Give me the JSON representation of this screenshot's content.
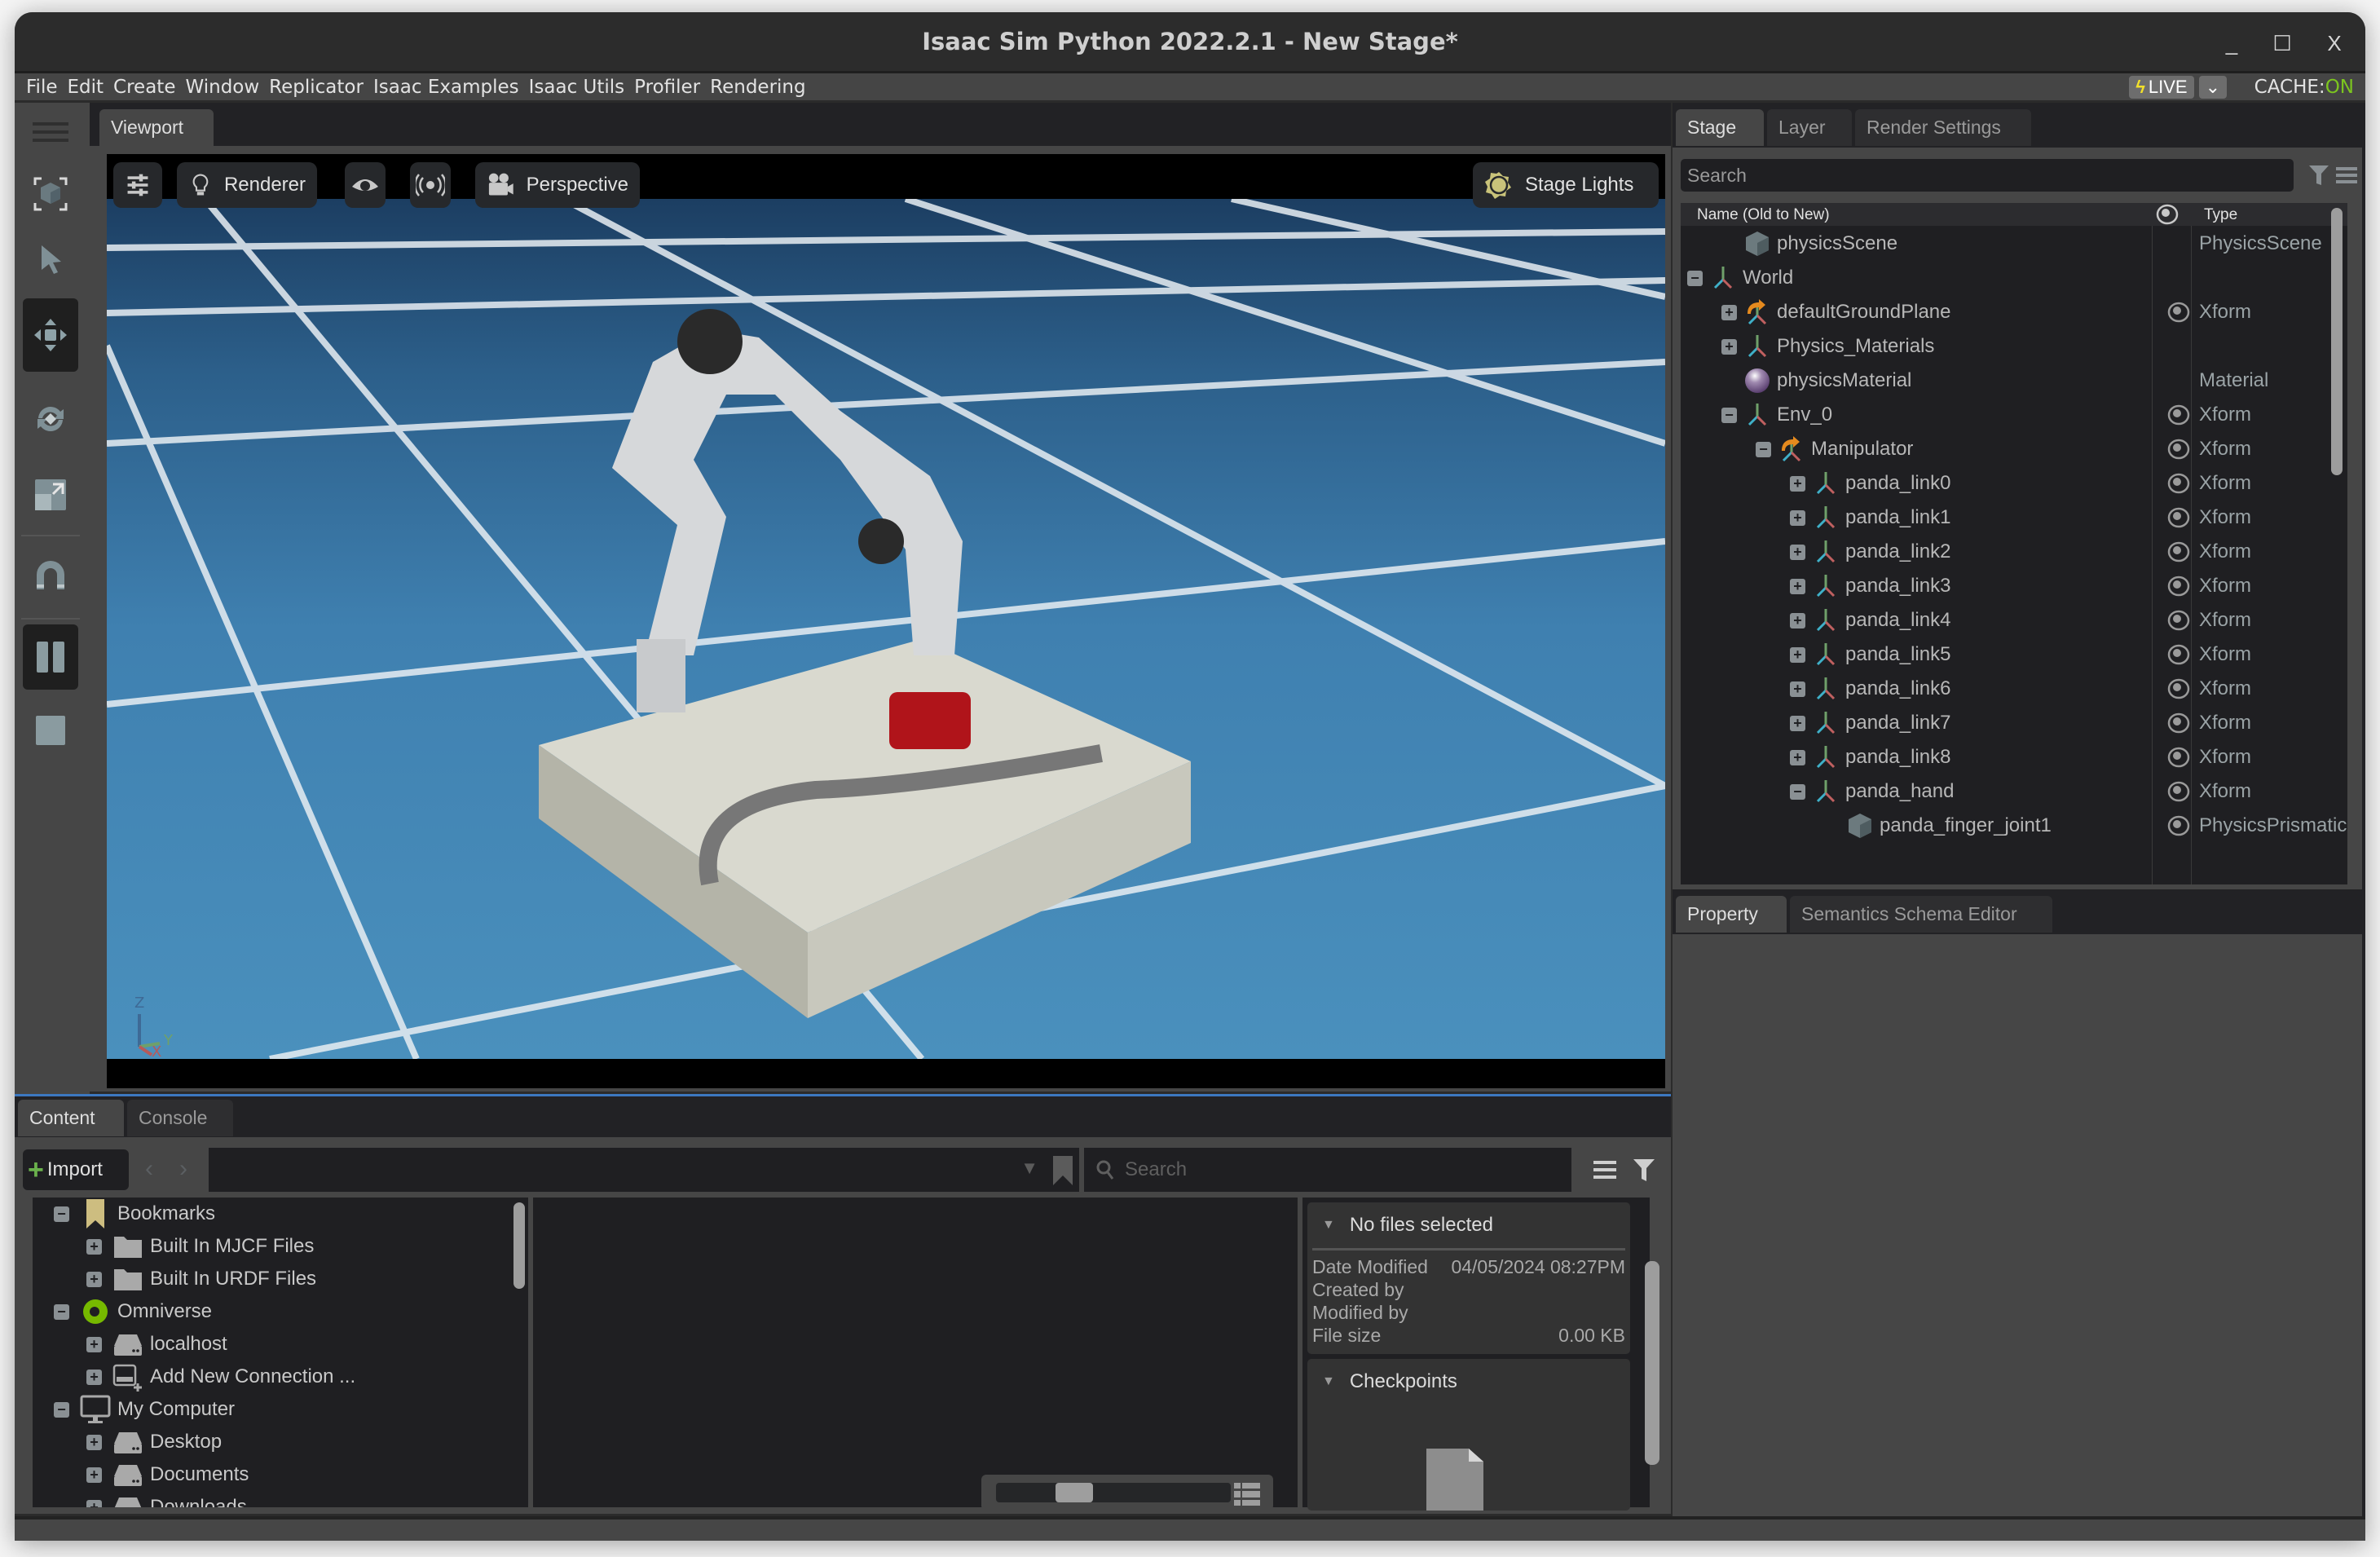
{
  "window": {
    "title": "Isaac Sim Python 2022.2.1 - New Stage*",
    "controls": {
      "minimize": "_",
      "maximize": "☐",
      "close": "X"
    }
  },
  "menu": [
    "File",
    "Edit",
    "Create",
    "Window",
    "Replicator",
    "Isaac Examples",
    "Isaac Utils",
    "Profiler",
    "Rendering"
  ],
  "status_bar": {
    "live_label": "LIVE",
    "live_icon": "lightning-bolt-icon",
    "cache_label": "CACHE:",
    "cache_value": "ON",
    "colors": {
      "cache_on": "#7cc51f",
      "live_bolt": "#f2e02a"
    }
  },
  "left_toolbar": [
    {
      "name": "frame-selection-icon",
      "active": false
    },
    {
      "name": "select-icon",
      "active": false
    },
    {
      "name": "move-icon",
      "active": true
    },
    {
      "name": "rotate-icon",
      "active": false
    },
    {
      "name": "scale-icon",
      "active": false
    },
    {
      "name": "snap-magnet-icon",
      "active": false
    },
    {
      "name": "pause-icon",
      "active": true
    },
    {
      "name": "stop-icon",
      "active": false
    }
  ],
  "viewport": {
    "tab_label": "Viewport",
    "buttons": {
      "settings_icon": "sliders-icon",
      "renderer": "Renderer",
      "visibility_icon": "eye-icon",
      "sensor_icon": "broadcast-icon",
      "camera": "Perspective",
      "lights": "Stage Lights"
    },
    "axis_labels": {
      "z": "Z",
      "y": "Y",
      "x": "X"
    }
  },
  "stage": {
    "tabs": [
      "Stage",
      "Layer",
      "Render Settings"
    ],
    "active_tab": "Stage",
    "search_placeholder": "Search",
    "columns": {
      "name": "Name (Old to New)",
      "type": "Type"
    },
    "rows": [
      {
        "name": "physicsScene",
        "type": "PhysicsScene",
        "depth": 1,
        "expander": "",
        "icon": "cube",
        "eye": false
      },
      {
        "name": "World",
        "type": "",
        "depth": 0,
        "expander": "minus",
        "icon": "xform",
        "eye": false
      },
      {
        "name": "defaultGroundPlane",
        "type": "Xform",
        "depth": 1,
        "expander": "plus",
        "icon": "xform-ref",
        "eye": true
      },
      {
        "name": "Physics_Materials",
        "type": "",
        "depth": 1,
        "expander": "plus",
        "icon": "xform",
        "eye": false
      },
      {
        "name": "physicsMaterial",
        "type": "Material",
        "depth": 1,
        "expander": "",
        "icon": "sphere",
        "eye": false
      },
      {
        "name": "Env_0",
        "type": "Xform",
        "depth": 1,
        "expander": "minus",
        "icon": "xform",
        "eye": true
      },
      {
        "name": "Manipulator",
        "type": "Xform",
        "depth": 2,
        "expander": "minus",
        "icon": "xform-ref",
        "eye": true
      },
      {
        "name": "panda_link0",
        "type": "Xform",
        "depth": 3,
        "expander": "plus",
        "icon": "xform",
        "eye": true
      },
      {
        "name": "panda_link1",
        "type": "Xform",
        "depth": 3,
        "expander": "plus",
        "icon": "xform",
        "eye": true
      },
      {
        "name": "panda_link2",
        "type": "Xform",
        "depth": 3,
        "expander": "plus",
        "icon": "xform",
        "eye": true
      },
      {
        "name": "panda_link3",
        "type": "Xform",
        "depth": 3,
        "expander": "plus",
        "icon": "xform",
        "eye": true
      },
      {
        "name": "panda_link4",
        "type": "Xform",
        "depth": 3,
        "expander": "plus",
        "icon": "xform",
        "eye": true
      },
      {
        "name": "panda_link5",
        "type": "Xform",
        "depth": 3,
        "expander": "plus",
        "icon": "xform",
        "eye": true
      },
      {
        "name": "panda_link6",
        "type": "Xform",
        "depth": 3,
        "expander": "plus",
        "icon": "xform",
        "eye": true
      },
      {
        "name": "panda_link7",
        "type": "Xform",
        "depth": 3,
        "expander": "plus",
        "icon": "xform",
        "eye": true
      },
      {
        "name": "panda_link8",
        "type": "Xform",
        "depth": 3,
        "expander": "plus",
        "icon": "xform",
        "eye": true
      },
      {
        "name": "panda_hand",
        "type": "Xform",
        "depth": 3,
        "expander": "minus",
        "icon": "xform",
        "eye": true
      },
      {
        "name": "panda_finger_joint1",
        "type": "PhysicsPrismatic",
        "depth": 4,
        "expander": "",
        "icon": "cube",
        "eye": true
      }
    ]
  },
  "property": {
    "tabs": [
      "Property",
      "Semantics Schema Editor"
    ],
    "active_tab": "Property"
  },
  "content": {
    "tabs": [
      "Content",
      "Console"
    ],
    "active_tab": "Content",
    "import_label": "Import",
    "search_placeholder": "Search",
    "tree": [
      {
        "label": "Bookmarks",
        "depth": 0,
        "expander": "minus",
        "icon": "bookmark"
      },
      {
        "label": "Built In MJCF Files",
        "depth": 1,
        "expander": "plus",
        "icon": "folder"
      },
      {
        "label": "Built In URDF Files",
        "depth": 1,
        "expander": "plus",
        "icon": "folder"
      },
      {
        "label": "Omniverse",
        "depth": 0,
        "expander": "minus",
        "icon": "omniverse"
      },
      {
        "label": "localhost",
        "depth": 1,
        "expander": "plus",
        "icon": "drive"
      },
      {
        "label": "Add New Connection ...",
        "depth": 1,
        "expander": "plus",
        "icon": "add-drive"
      },
      {
        "label": "My Computer",
        "depth": 0,
        "expander": "minus",
        "icon": "monitor"
      },
      {
        "label": "Desktop",
        "depth": 1,
        "expander": "plus",
        "icon": "drive"
      },
      {
        "label": "Documents",
        "depth": 1,
        "expander": "plus",
        "icon": "drive"
      },
      {
        "label": "Downloads",
        "depth": 1,
        "expander": "plus",
        "icon": "drive"
      }
    ],
    "thumbnail_size": 0.3,
    "details": {
      "header": "No files selected",
      "date_modified_label": "Date Modified",
      "date_modified_value": "04/05/2024 08:27PM",
      "created_by_label": "Created by",
      "modified_by_label": "Modified by",
      "file_size_label": "File size",
      "file_size_value": "0.00 KB",
      "checkpoints_header": "Checkpoints"
    }
  }
}
